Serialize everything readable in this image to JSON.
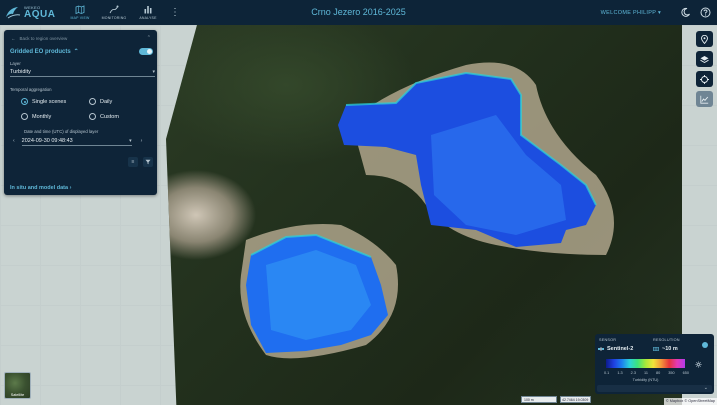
{
  "app": {
    "logo_small": "WEKEO",
    "logo_big": "AQUA",
    "title": "Crno Jezero 2016-2025",
    "welcome": "WELCOME PHILIPP",
    "welcome_caret": "▾"
  },
  "nav": {
    "tabs": [
      {
        "label": "MAP VIEW",
        "icon": "map-icon",
        "active": true
      },
      {
        "label": "MONITORING",
        "icon": "satellite-icon",
        "active": false
      },
      {
        "label": "ANALYSE",
        "icon": "bar-chart-icon",
        "active": false
      }
    ],
    "more": "⋮"
  },
  "panel": {
    "back_label": "Back to region overview",
    "section_title": "Gridded EO products",
    "layer_label": "Layer",
    "layer_value": "Turbidity",
    "temporal_label": "Temporal aggregation",
    "options": [
      {
        "label": "Single scenes",
        "checked": true
      },
      {
        "label": "Daily",
        "checked": false
      },
      {
        "label": "Monthly",
        "checked": false
      },
      {
        "label": "Custom",
        "checked": false
      }
    ],
    "date_label": "Date and time (UTC) of displayed layer",
    "date_value": "2024-09-30 09:48:43",
    "insitu_label": "In situ and model data",
    "insitu_arrow": "›",
    "toggle_on": true
  },
  "legend": {
    "sensor_header": "SENSOR",
    "sensor_value": "Sentinel-2",
    "resolution_header": "RESOLUTION",
    "resolution_value": "~10 m",
    "ticks": [
      "0.1",
      "1.3",
      "2.3",
      "11",
      "80",
      "350",
      "650"
    ],
    "unit": "Turbidity (NTU)",
    "colors": [
      "#0c1b8a",
      "#1f3fe0",
      "#1c7ef0",
      "#2bd3d8",
      "#3de27a",
      "#a6e83a",
      "#f1e33a",
      "#f3953a",
      "#e6343a",
      "#e43ab5",
      "#b23ae8"
    ]
  },
  "map": {
    "basemap_label": "Satellite",
    "scale": "100 m",
    "coords": "42.7464 19.0309",
    "attribution": "© Mapbox © OpenStreetMap"
  },
  "accent_color": "#5fb8d8"
}
